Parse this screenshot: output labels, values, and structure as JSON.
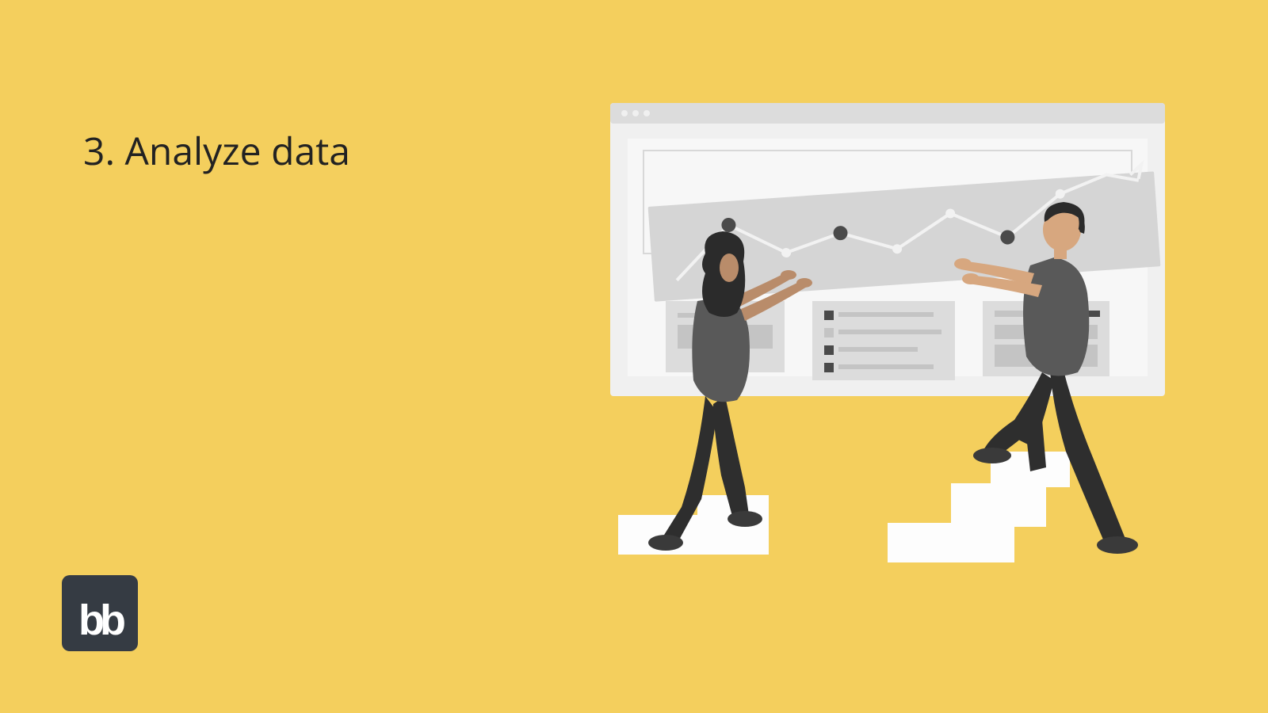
{
  "title": "3. Analyze data",
  "logo_text": "bb"
}
